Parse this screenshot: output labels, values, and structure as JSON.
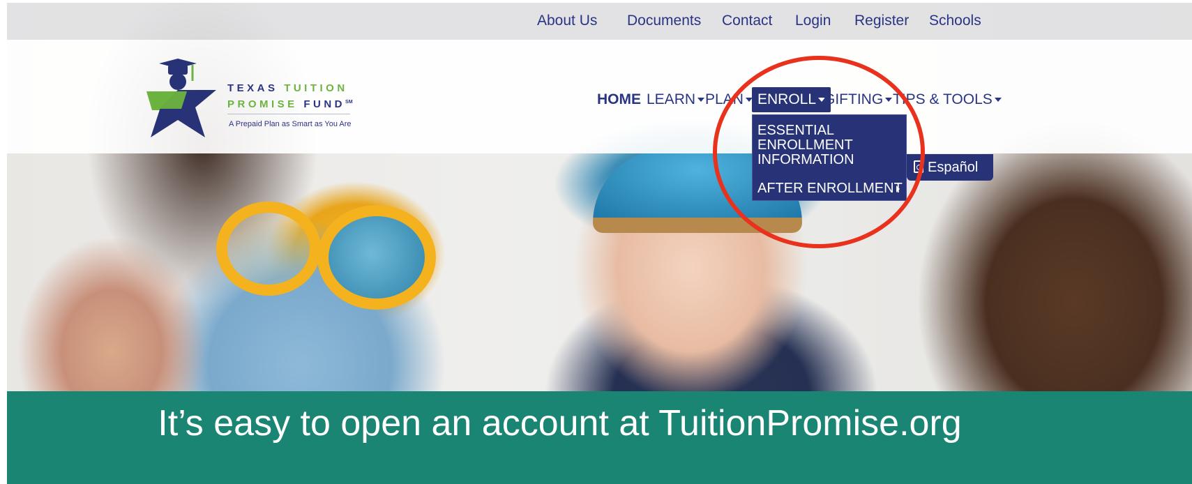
{
  "colors": {
    "navy": "#283377",
    "link_navy": "#2a3484",
    "logo_green": "#6cb33f",
    "banner_teal": "#1b8574",
    "annotation_red": "#e8321e"
  },
  "utility_nav": {
    "items": [
      "About Us",
      "Documents",
      "Contact",
      "Login",
      "Register",
      "Schools"
    ]
  },
  "logo": {
    "line1_a": "TEXAS",
    "line1_b": "TUITION",
    "line2_a": "PROMISE",
    "line2_b": "FUND",
    "mark": "SM",
    "tagline": "A Prepaid Plan as Smart as You Are",
    "icon": "graduate-star-icon"
  },
  "main_nav": {
    "home": "HOME",
    "learn": "LEARN",
    "plan": "PLAN",
    "enroll": "ENROLL",
    "gifting": "GIFTING",
    "tips": "TIPS & TOOLS",
    "active": "ENROLL"
  },
  "enroll_dropdown": {
    "items": [
      "ESSENTIAL ENROLLMENT INFORMATION",
      "AFTER ENROLLMENT"
    ]
  },
  "espanol_button": {
    "label": "Español",
    "icon": "pdf-icon"
  },
  "banner": {
    "text": "It’s easy to open an account at TuitionPromise.org"
  }
}
